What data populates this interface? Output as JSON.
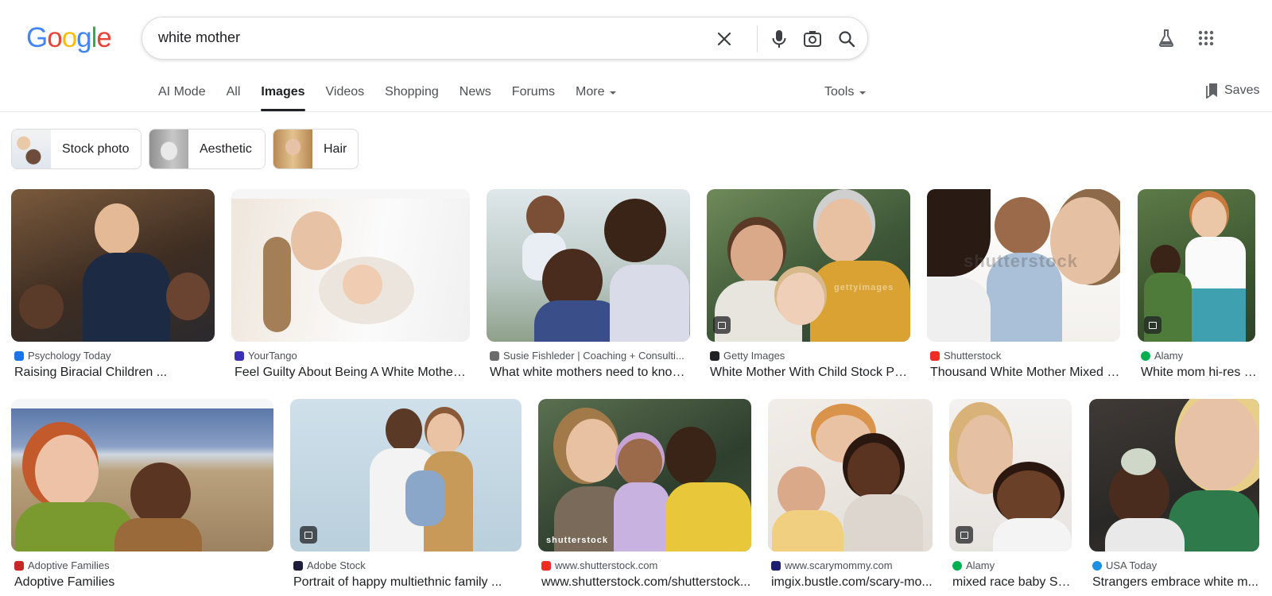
{
  "logo": {
    "letters": [
      "G",
      "o",
      "o",
      "g",
      "l",
      "e"
    ],
    "colors": [
      "#4285F4",
      "#EA4335",
      "#FBBC05",
      "#4285F4",
      "#34A853",
      "#EA4335"
    ]
  },
  "search": {
    "query": "white mother",
    "placeholder": ""
  },
  "header_icons": [
    "labs-flask-icon",
    "apps-grid-icon"
  ],
  "tabs": [
    {
      "label": "AI Mode",
      "active": false
    },
    {
      "label": "All",
      "active": false
    },
    {
      "label": "Images",
      "active": true
    },
    {
      "label": "Videos",
      "active": false
    },
    {
      "label": "Shopping",
      "active": false
    },
    {
      "label": "News",
      "active": false
    },
    {
      "label": "Forums",
      "active": false
    },
    {
      "label": "More",
      "active": false
    }
  ],
  "tools_label": "Tools",
  "saves_label": "Saves",
  "chips": [
    {
      "label": "Stock photo"
    },
    {
      "label": "Aesthetic"
    },
    {
      "label": "Hair"
    }
  ],
  "results": [
    {
      "source": "Psychology Today",
      "title": "Raising Biracial Children ...",
      "favicon_color": "#1a73e8",
      "has_badge": false
    },
    {
      "source": "YourTango",
      "title": "Feel Guilty About Being A White Mother ...",
      "favicon_color": "#3a2fb5",
      "has_badge": false
    },
    {
      "source": "Susie Fishleder | Coaching + Consulti...",
      "title": "What white mothers need to know ...",
      "favicon_color": "#6b6b6b",
      "has_badge": false
    },
    {
      "source": "Getty Images",
      "title": "White Mother With Child Stock Ph...",
      "favicon_color": "#202124",
      "has_badge": true
    },
    {
      "source": "Shutterstock",
      "title": "Thousand White Mother Mixed R...",
      "favicon_color": "#ee2d24",
      "has_badge": false
    },
    {
      "source": "Alamy",
      "title": "White mom hi-res s...",
      "favicon_color": "#00b050",
      "has_badge": true
    },
    {
      "source": "Adoptive Families",
      "title": "Adoptive Families",
      "favicon_color": "#c62828",
      "has_badge": false
    },
    {
      "source": "Adobe Stock",
      "title": "Portrait of happy multiethnic family ...",
      "favicon_color": "#1d1d3a",
      "has_badge": true
    },
    {
      "source": "www.shutterstock.com",
      "title": "www.shutterstock.com/shutterstock...",
      "favicon_color": "#ee2d24",
      "has_badge": false
    },
    {
      "source": "www.scarymommy.com",
      "title": "imgix.bustle.com/scary-mo...",
      "favicon_color": "#1e1e6e",
      "has_badge": false
    },
    {
      "source": "Alamy",
      "title": "mixed race baby St...",
      "favicon_color": "#00b050",
      "has_badge": true
    },
    {
      "source": "USA Today",
      "title": "Strangers embrace white m...",
      "favicon_color": "#1a8fe3",
      "has_badge": false
    }
  ],
  "watermarks": {
    "getty": "gettyimages",
    "shutter": "shutterstock"
  }
}
